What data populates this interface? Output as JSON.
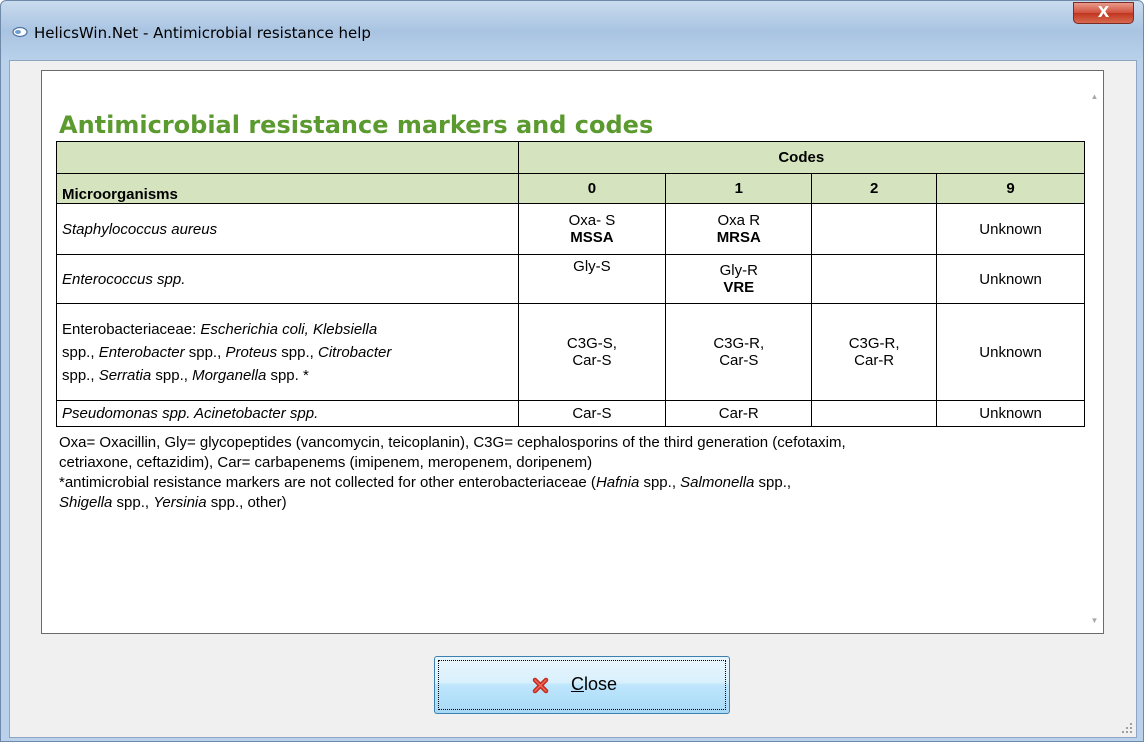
{
  "window": {
    "title": "HelicsWin.Net - Antimicrobial resistance help",
    "close_glyph": "X"
  },
  "content": {
    "heading": "Antimicrobial resistance markers and codes",
    "table": {
      "codes_header": "Codes",
      "microorganisms_header": "Microorganisms",
      "code_columns": [
        "0",
        "1",
        "2",
        "9"
      ],
      "rows": [
        {
          "organism": "Staphylococcus  aureus",
          "c0": "Oxa- S",
          "c0b": "MSSA",
          "c1": "Oxa R",
          "c1b": "MRSA",
          "c2": "",
          "c9": "Unknown"
        },
        {
          "organism": "Enterococcus spp.",
          "c0": "Gly-S",
          "c1": "Gly-R",
          "c1b": "VRE",
          "c2": "",
          "c9": "Unknown"
        },
        {
          "organism_parts": [
            "Enterobacteriaceae: ",
            "Escherichia coli, Klebsiella",
            "spp., ",
            "Enterobacter",
            " spp., ",
            "Proteus",
            " spp., ",
            "Citrobacter",
            "spp., ",
            "Serratia",
            " spp.,  ",
            "Morganella",
            " spp. *"
          ],
          "c0": "C3G-S,",
          "c0b": "Car-S",
          "c1": "C3G-R,",
          "c1b": "Car-S",
          "c2": "C3G-R,",
          "c2b": "Car-R",
          "c9": "Unknown"
        },
        {
          "organism": "Pseudomonas spp. Acinetobacter spp.",
          "c0": "Car-S",
          "c1": "Car-R",
          "c2": "",
          "c9": "Unknown"
        }
      ]
    },
    "notes": {
      "line1": "Oxa= Oxacillin, Gly= glycopeptides (vancomycin, teicoplanin), C3G= cephalosporins of the third generation (cefotaxim,",
      "line2": "cetriaxone, ceftazidim), Car= carbapenems (imipenem, meropenem, doripenem)",
      "line3_parts": [
        "*antimicrobial resistance markers are not collected for other enterobacteriaceae (",
        "Hafnia",
        " spp., ",
        "Salmonella",
        " spp.,"
      ],
      "line4_parts": [
        "Shigella",
        " spp., ",
        "Yersinia",
        " spp., other)"
      ]
    }
  },
  "footer": {
    "close_button": {
      "mnemonic": "C",
      "rest": "lose",
      "icon": "red-x-icon"
    }
  },
  "colors": {
    "heading": "#5b9a2f",
    "table_header_bg": "#d5e4bf",
    "button_border": "#3c7fb1"
  }
}
